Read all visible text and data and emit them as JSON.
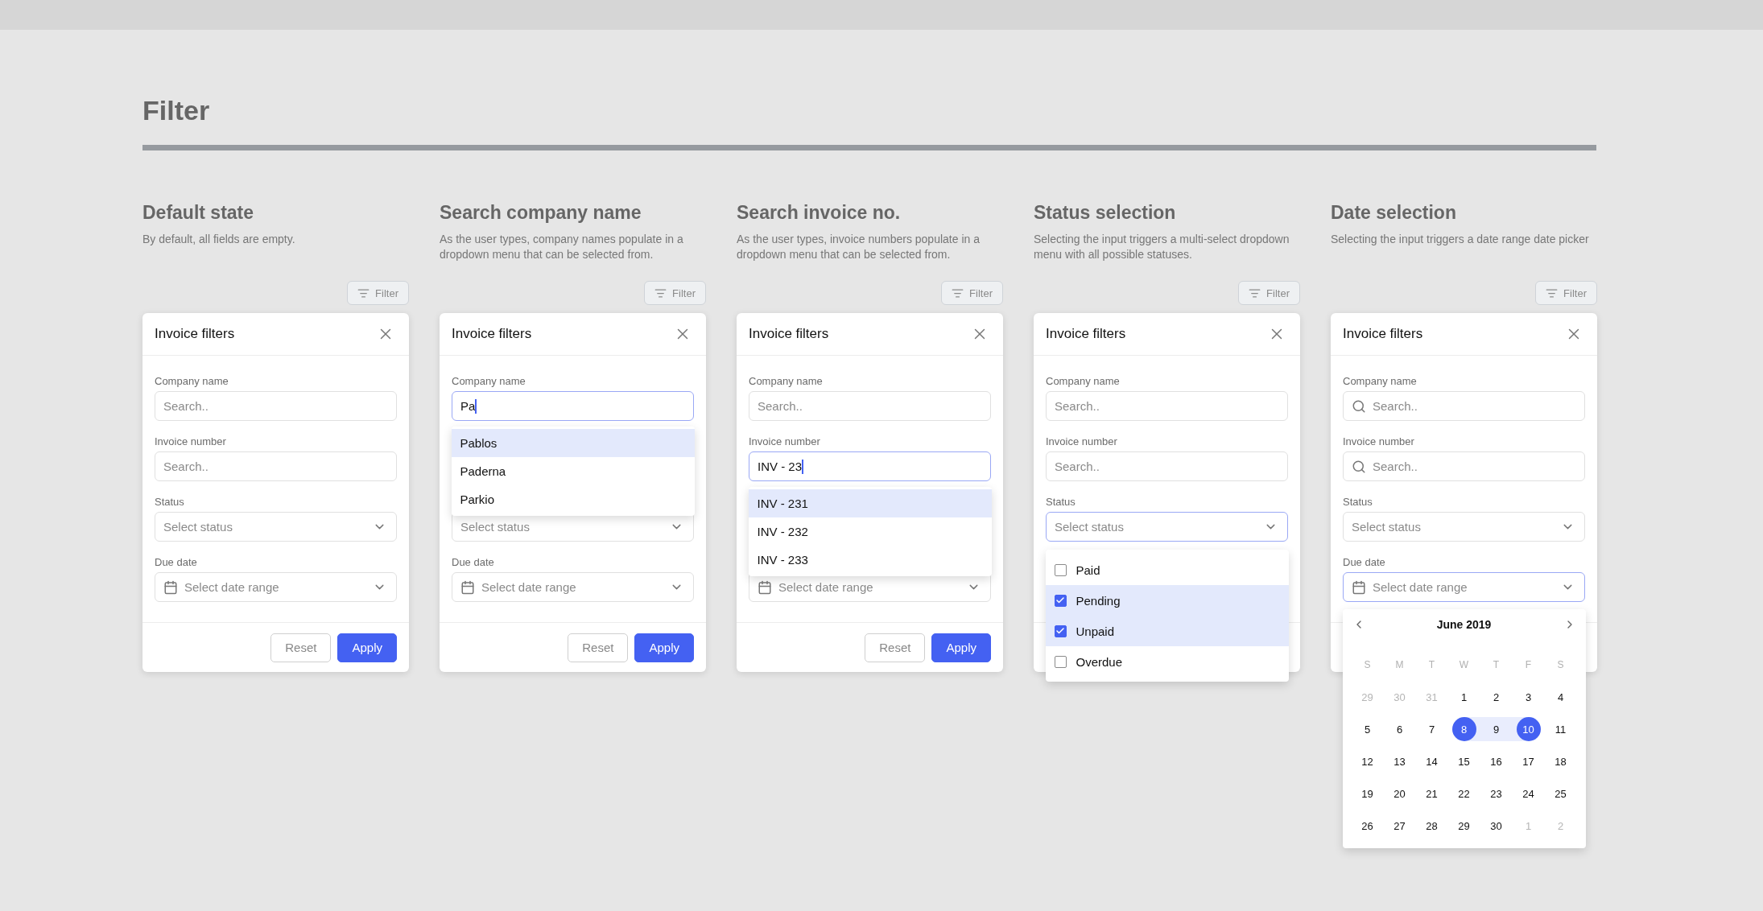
{
  "title": "Filter",
  "panels": [
    {
      "heading": "Default state",
      "description": "By default, all fields are empty.",
      "filter_button": "Filter",
      "card": {
        "title": "Invoice filters",
        "fields": [
          {
            "kind": "company",
            "label": "Company name",
            "placeholder": "Search..",
            "search_icon": false,
            "focused": false
          },
          {
            "kind": "invoice",
            "label": "Invoice number",
            "placeholder": "Search..",
            "search_icon": false,
            "focused": false
          },
          {
            "kind": "status",
            "label": "Status",
            "placeholder": "Select status",
            "focused": false
          },
          {
            "kind": "date",
            "label": "Due date",
            "placeholder": "Select date range",
            "focused": false
          }
        ],
        "buttons": [
          {
            "label": "Reset",
            "kind": "secondary"
          },
          {
            "label": "Apply",
            "kind": "primary"
          }
        ]
      }
    },
    {
      "heading": "Search company name",
      "description": "As the user types, company names populate in a dropdown menu that can be selected from.",
      "filter_button": "Filter",
      "card": {
        "title": "Invoice filters",
        "fields": [
          {
            "kind": "company",
            "label": "Company name",
            "value": "Pa",
            "search_icon": false,
            "focused": true,
            "options": [
              {
                "label": "Pablos",
                "selected": true
              },
              {
                "label": "Paderna",
                "selected": false
              },
              {
                "label": "Parkio",
                "selected": false
              }
            ]
          },
          {
            "kind": "status",
            "placeholder": "Select status",
            "focused": false
          },
          {
            "kind": "date",
            "label": "Due date",
            "placeholder": "Select date range",
            "focused": false
          }
        ],
        "buttons": [
          {
            "label": "Reset",
            "kind": "secondary"
          },
          {
            "label": "Apply",
            "kind": "primary"
          }
        ]
      }
    },
    {
      "heading": "Search invoice no.",
      "description": "As the user types, invoice numbers populate in a dropdown menu that can be selected from.",
      "filter_button": "Filter",
      "card": {
        "title": "Invoice filters",
        "fields": [
          {
            "kind": "company",
            "label": "Company name",
            "placeholder": "Search..",
            "search_icon": false,
            "focused": false
          },
          {
            "kind": "invoice",
            "label": "Invoice number",
            "value": "INV - 23",
            "search_icon": false,
            "focused": true,
            "options": [
              {
                "label": "INV - 231",
                "selected": true
              },
              {
                "label": "INV - 232",
                "selected": false
              },
              {
                "label": "INV - 233",
                "selected": false
              }
            ]
          },
          {
            "kind": "date",
            "placeholder": "Select date range",
            "focused": false
          }
        ],
        "buttons": [
          {
            "label": "Reset",
            "kind": "secondary"
          },
          {
            "label": "Apply",
            "kind": "primary"
          }
        ]
      }
    },
    {
      "heading": "Status selection",
      "description": "Selecting the input triggers a multi-select dropdown menu with all possible statuses.",
      "filter_button": "Filter",
      "card": {
        "title": "Invoice filters",
        "fields": [
          {
            "kind": "company",
            "label": "Company name",
            "placeholder": "Search..",
            "search_icon": false,
            "focused": false
          },
          {
            "kind": "invoice",
            "label": "Invoice number",
            "placeholder": "Search..",
            "search_icon": false,
            "focused": false
          },
          {
            "kind": "status",
            "label": "Status",
            "placeholder": "Select status",
            "focused": true,
            "checklist": [
              {
                "label": "Paid",
                "checked": false
              },
              {
                "label": "Pending",
                "checked": true
              },
              {
                "label": "Unpaid",
                "checked": true
              },
              {
                "label": "Overdue",
                "checked": false
              }
            ]
          }
        ]
      }
    },
    {
      "heading": "Date selection",
      "description": "Selecting the input triggers a date range date picker",
      "filter_button": "Filter",
      "card": {
        "title": "Invoice filters",
        "fields": [
          {
            "kind": "company",
            "label": "Company name",
            "placeholder": "Search..",
            "search_icon": true,
            "focused": false
          },
          {
            "kind": "invoice",
            "label": "Invoice number",
            "placeholder": "Search..",
            "search_icon": true,
            "focused": false
          },
          {
            "kind": "status",
            "label": "Status",
            "placeholder": "Select status",
            "focused": false
          },
          {
            "kind": "date",
            "label": "Due date",
            "placeholder": "Select date range",
            "focused": true,
            "calendar": {
              "month": "June 2019",
              "weekdays": [
                "S",
                "M",
                "T",
                "W",
                "T",
                "F",
                "S"
              ],
              "weeks": [
                [
                  {
                    "day": "29",
                    "muted": true,
                    "selected": false,
                    "in_range": false
                  },
                  {
                    "day": "30",
                    "muted": true,
                    "selected": false,
                    "in_range": false
                  },
                  {
                    "day": "31",
                    "muted": true,
                    "selected": false,
                    "in_range": false
                  },
                  {
                    "day": "1",
                    "muted": false,
                    "selected": false,
                    "in_range": false
                  },
                  {
                    "day": "2",
                    "muted": false,
                    "selected": false,
                    "in_range": false
                  },
                  {
                    "day": "3",
                    "muted": false,
                    "selected": false,
                    "in_range": false
                  },
                  {
                    "day": "4",
                    "muted": false,
                    "selected": false,
                    "in_range": false
                  }
                ],
                [
                  {
                    "day": "5",
                    "muted": false,
                    "selected": false,
                    "in_range": false
                  },
                  {
                    "day": "6",
                    "muted": false,
                    "selected": false,
                    "in_range": false
                  },
                  {
                    "day": "7",
                    "muted": false,
                    "selected": false,
                    "in_range": false
                  },
                  {
                    "day": "8",
                    "muted": false,
                    "selected": true,
                    "in_range": false
                  },
                  {
                    "day": "9",
                    "muted": false,
                    "selected": false,
                    "in_range": true
                  },
                  {
                    "day": "10",
                    "muted": false,
                    "selected": true,
                    "in_range": false
                  },
                  {
                    "day": "11",
                    "muted": false,
                    "selected": false,
                    "in_range": false
                  }
                ],
                [
                  {
                    "day": "12",
                    "muted": false,
                    "selected": false,
                    "in_range": false
                  },
                  {
                    "day": "13",
                    "muted": false,
                    "selected": false,
                    "in_range": false
                  },
                  {
                    "day": "14",
                    "muted": false,
                    "selected": false,
                    "in_range": false
                  },
                  {
                    "day": "15",
                    "muted": false,
                    "selected": false,
                    "in_range": false
                  },
                  {
                    "day": "16",
                    "muted": false,
                    "selected": false,
                    "in_range": false
                  },
                  {
                    "day": "17",
                    "muted": false,
                    "selected": false,
                    "in_range": false
                  },
                  {
                    "day": "18",
                    "muted": false,
                    "selected": false,
                    "in_range": false
                  }
                ],
                [
                  {
                    "day": "19",
                    "muted": false,
                    "selected": false,
                    "in_range": false
                  },
                  {
                    "day": "20",
                    "muted": false,
                    "selected": false,
                    "in_range": false
                  },
                  {
                    "day": "21",
                    "muted": false,
                    "selected": false,
                    "in_range": false
                  },
                  {
                    "day": "22",
                    "muted": false,
                    "selected": false,
                    "in_range": false
                  },
                  {
                    "day": "23",
                    "muted": false,
                    "selected": false,
                    "in_range": false
                  },
                  {
                    "day": "24",
                    "muted": false,
                    "selected": false,
                    "in_range": false
                  },
                  {
                    "day": "25",
                    "muted": false,
                    "selected": false,
                    "in_range": false
                  }
                ],
                [
                  {
                    "day": "26",
                    "muted": false,
                    "selected": false,
                    "in_range": false
                  },
                  {
                    "day": "27",
                    "muted": false,
                    "selected": false,
                    "in_range": false
                  },
                  {
                    "day": "28",
                    "muted": false,
                    "selected": false,
                    "in_range": false
                  },
                  {
                    "day": "29",
                    "muted": false,
                    "selected": false,
                    "in_range": false
                  },
                  {
                    "day": "30",
                    "muted": false,
                    "selected": false,
                    "in_range": false
                  },
                  {
                    "day": "1",
                    "muted": true,
                    "selected": false,
                    "in_range": false
                  },
                  {
                    "day": "2",
                    "muted": true,
                    "selected": false,
                    "in_range": false
                  }
                ]
              ]
            }
          }
        ]
      }
    }
  ]
}
